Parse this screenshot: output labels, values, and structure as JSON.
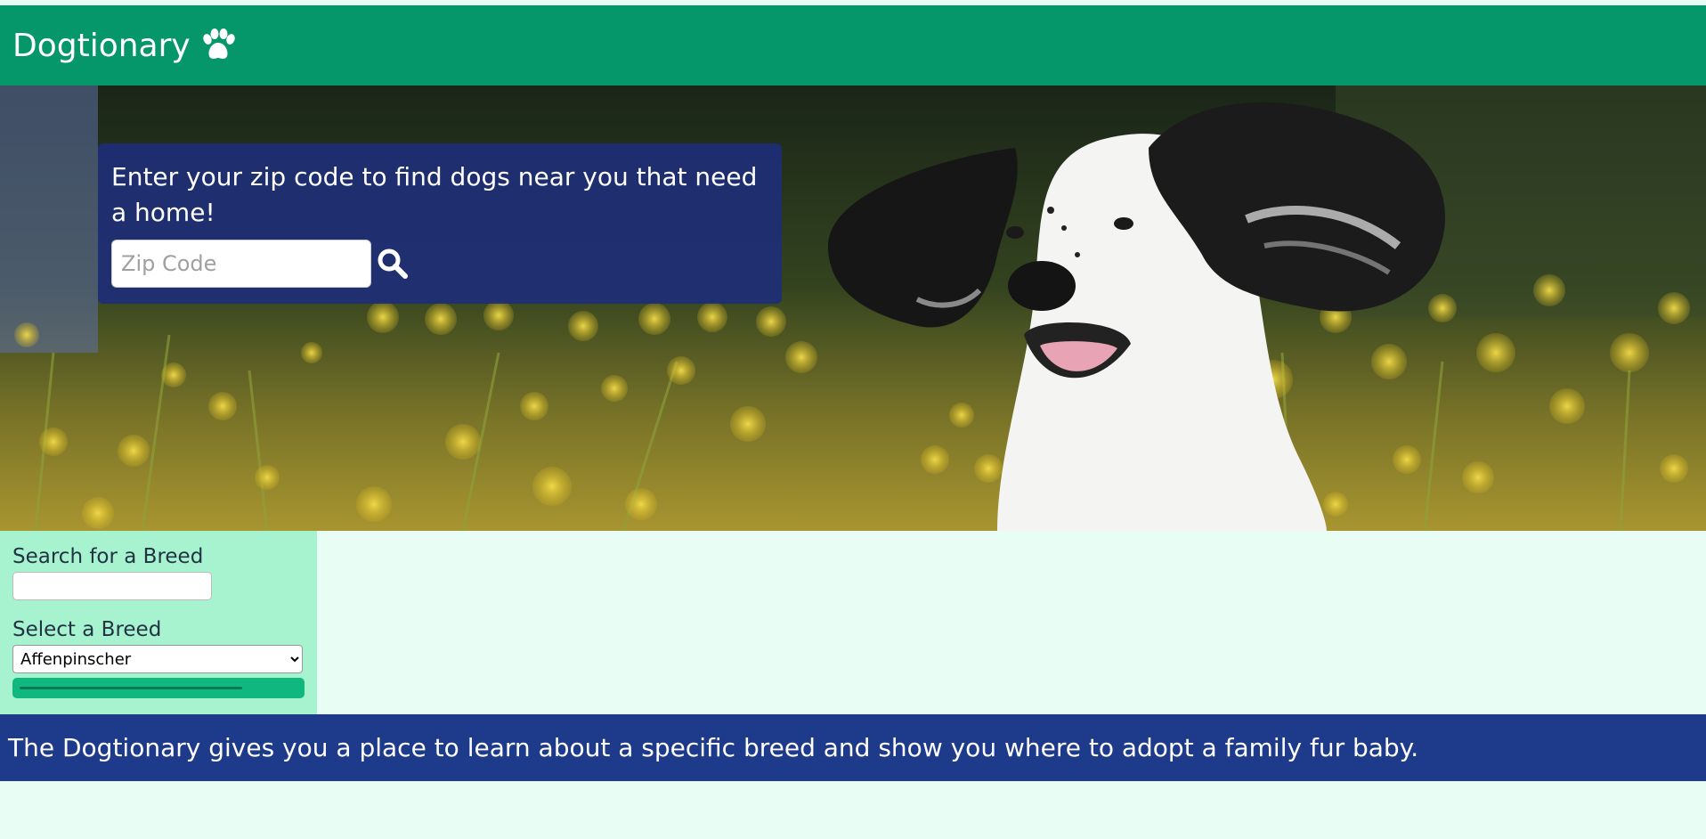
{
  "navbar": {
    "brand": "Dogtionary",
    "brand_icon": "paw-icon",
    "color": "#05966a"
  },
  "hero": {
    "zip_prompt": "Enter your zip code to find dogs near you that need a home!",
    "zip_placeholder": "Zip Code",
    "search_icon": "search-icon"
  },
  "breed_panel": {
    "search_label": "Search for a Breed",
    "search_value": "",
    "select_label": "Select a Breed",
    "selected_breed": "Affenpinscher"
  },
  "footer": {
    "text": "The Dogtionary gives you a place to learn about a specific breed and show you where to adopt a family fur baby.",
    "color": "#1e3a8a"
  }
}
